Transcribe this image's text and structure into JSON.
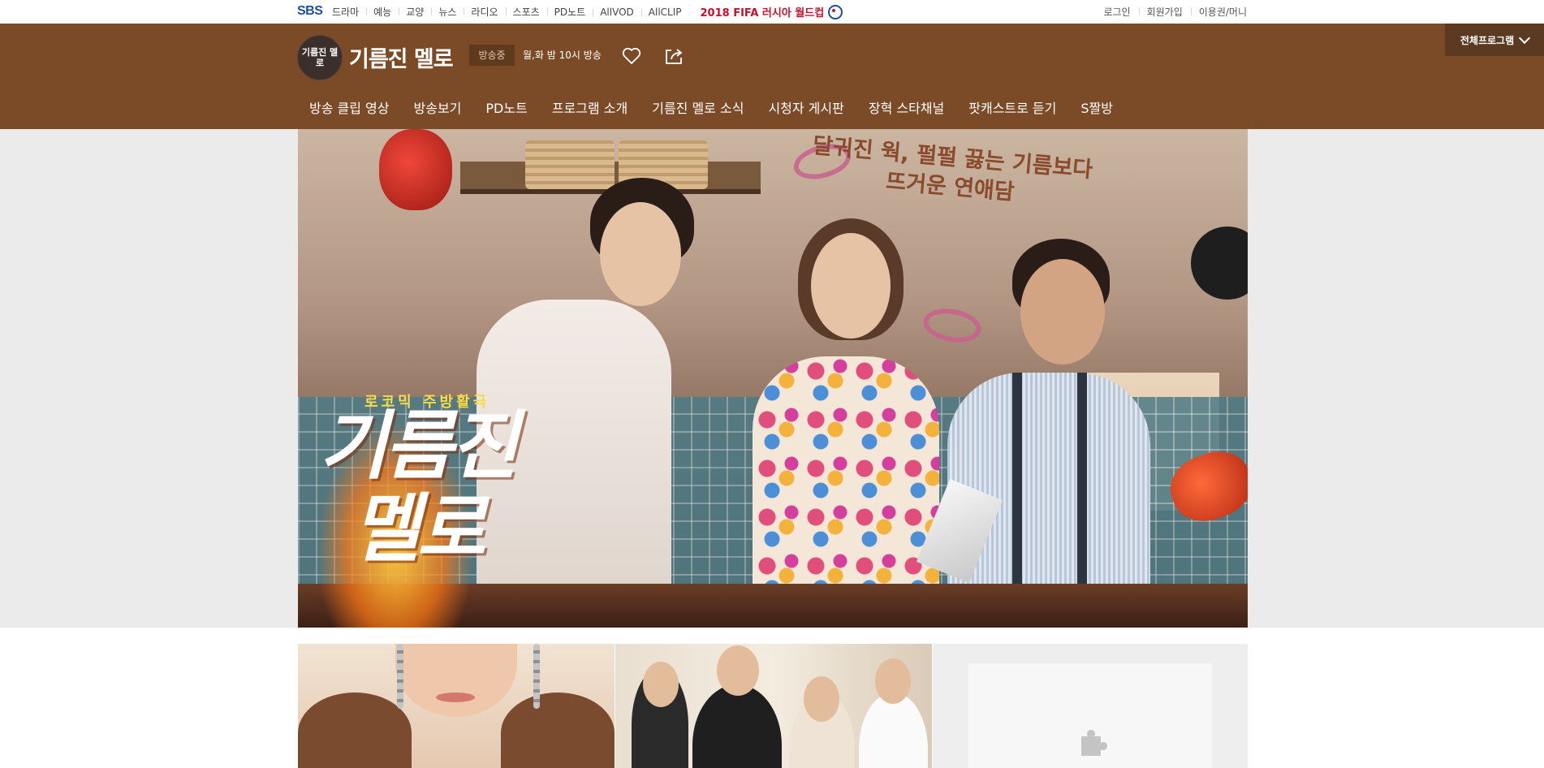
{
  "gnb": {
    "logo": "SBS",
    "menu": [
      "드라마",
      "예능",
      "교양",
      "뉴스",
      "라디오",
      "스포츠",
      "PD노트",
      "AllVOD",
      "AllCLIP"
    ],
    "promo": "2018 FIFA 러시아 월드컵",
    "right": [
      "로그인",
      "회원가입",
      "이용권/머니"
    ]
  },
  "program": {
    "logo_text": "기름진 멜로",
    "title": "기름진 멜로",
    "status": "방송중",
    "airtime": "월,화 밤 10시 방송",
    "all_programs": "전체프로그램",
    "nav": [
      "방송 클립 영상",
      "방송보기",
      "PD노트",
      "프로그램 소개",
      "기름진 멜로 소식",
      "시청자 게시판",
      "장혁 스타채널",
      "팟캐스트로 듣기",
      "S짤방"
    ]
  },
  "hero": {
    "tagline_1": "달궈진 웍, 펄펄 끓는 기름보다",
    "tagline_2": "뜨거운 연애담",
    "genre": "로코믹 주방활극",
    "title_line1": "기름진",
    "title_line2": "멜로"
  },
  "colors": {
    "header_brown": "#7b4a26",
    "all_programs_bg": "#5c3a21",
    "onair_bg": "#5f3a1d",
    "sbs_blue": "#1d4fa3",
    "fifa_red": "#c8102e"
  },
  "icons": {
    "like": "heart-icon",
    "share": "share-icon",
    "dropdown": "chevron-down-icon",
    "placeholder": "puzzle-icon"
  }
}
